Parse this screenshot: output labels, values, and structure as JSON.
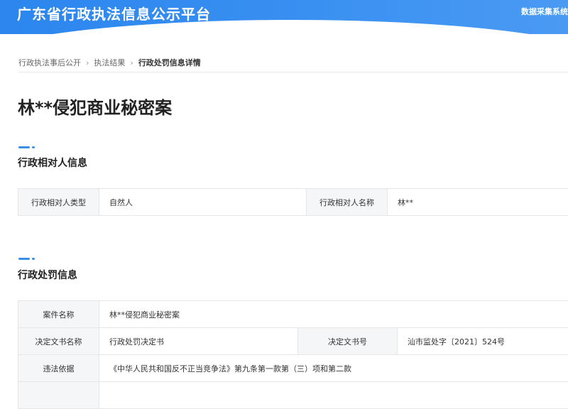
{
  "header": {
    "site_title": "广东省行政执法信息公示平台",
    "right_link": "数据采集系统"
  },
  "breadcrumb": {
    "items": [
      "行政执法事后公开",
      "执法结果",
      "行政处罚信息详情"
    ],
    "separator": "›"
  },
  "page_title": "林**侵犯商业秘密案",
  "party_section": {
    "title": "行政相对人信息",
    "rows": [
      {
        "label1": "行政相对人类型",
        "value1": "自然人",
        "label2": "行政相对人名称",
        "value2": "林**"
      }
    ]
  },
  "penalty_section": {
    "title": "行政处罚信息",
    "case_name_label": "案件名称",
    "case_name_value": "林**侵犯商业秘密案",
    "doc_name_label": "决定文书名称",
    "doc_name_value": "行政处罚决定书",
    "doc_no_label": "决定文书号",
    "doc_no_value": "汕市监处字〔2021〕524号",
    "basis_label": "违法依据",
    "basis_value": "《中华人民共和国反不正当竞争法》第九条第一款第（三）项和第二款"
  },
  "colors": {
    "brand": "#2d8cf0",
    "accent": "#3a8ee6",
    "label_bg": "#f5f6f8"
  }
}
